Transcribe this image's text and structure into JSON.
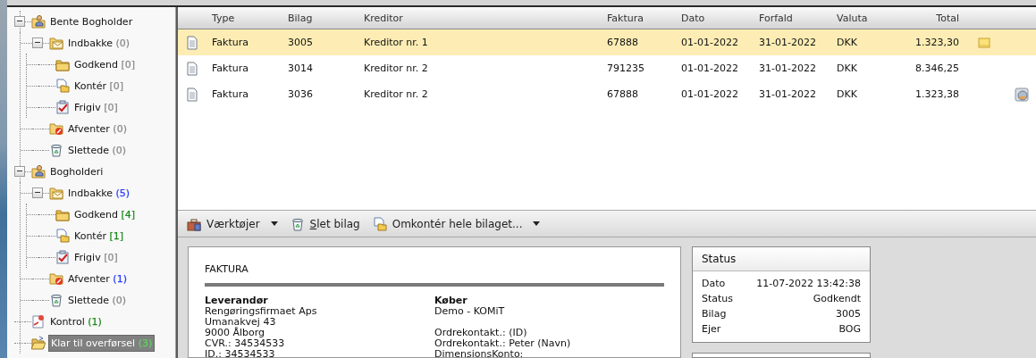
{
  "tree": [
    {
      "kind": "user",
      "label": "Bente Bogholder",
      "expanded": true,
      "selected": false,
      "children": [
        {
          "kind": "inbox",
          "label": "Indbakke",
          "count": "(0)",
          "color": "#8a8a8a",
          "expanded": true,
          "selected": false,
          "children": [
            {
              "kind": "approve",
              "label": "Godkend",
              "count": "[0]",
              "color": "#8a8a8a",
              "selected": false
            },
            {
              "kind": "post",
              "label": "Kontér",
              "count": "[0]",
              "color": "#8a8a8a",
              "selected": false
            },
            {
              "kind": "release",
              "label": "Frigiv",
              "count": "[0]",
              "color": "#8a8a8a",
              "selected": false
            }
          ]
        },
        {
          "kind": "waiting",
          "label": "Afventer",
          "count": "(0)",
          "color": "#8a8a8a",
          "selected": false
        },
        {
          "kind": "deleted",
          "label": "Slettede",
          "count": "(0)",
          "color": "#8a8a8a",
          "selected": false
        }
      ]
    },
    {
      "kind": "user",
      "label": "Bogholderi",
      "expanded": true,
      "selected": false,
      "children": [
        {
          "kind": "inbox",
          "label": "Indbakke",
          "count": "(5)",
          "color": "#2a3cff",
          "expanded": true,
          "selected": false,
          "children": [
            {
              "kind": "approve",
              "label": "Godkend",
              "count": "[4]",
              "color": "#1e8a1e",
              "selected": false
            },
            {
              "kind": "post",
              "label": "Kontér",
              "count": "[1]",
              "color": "#1e8a1e",
              "selected": false
            },
            {
              "kind": "release",
              "label": "Frigiv",
              "count": "[0]",
              "color": "#8a8a8a",
              "selected": false
            }
          ]
        },
        {
          "kind": "waiting",
          "label": "Afventer",
          "count": "(1)",
          "color": "#2a3cff",
          "selected": false
        },
        {
          "kind": "deleted",
          "label": "Slettede",
          "count": "(0)",
          "color": "#8a8a8a",
          "selected": false
        }
      ]
    },
    {
      "kind": "control",
      "label": "Kontrol",
      "count": "(1)",
      "color": "#1e8a1e",
      "selected": false
    },
    {
      "kind": "transfer",
      "label": "Klar til overførsel",
      "count": "(3)",
      "color": "#5fd35f",
      "selected": true
    }
  ],
  "table": {
    "columns": [
      "Type",
      "Bilag",
      "Kreditor",
      "Faktura",
      "Dato",
      "Forfald",
      "Valuta",
      "Total"
    ],
    "rows": [
      {
        "selected": true,
        "note": true,
        "cells": [
          "Faktura",
          "3005",
          "Kreditor nr. 1",
          "67888",
          "01-01-2022",
          "31-01-2022",
          "DKK",
          "1.323,30"
        ]
      },
      {
        "selected": false,
        "cells": [
          "Faktura",
          "3014",
          "Kreditor nr. 2",
          "791235",
          "01-01-2022",
          "31-01-2022",
          "DKK",
          "8.346,25"
        ]
      },
      {
        "selected": false,
        "attachment": true,
        "cells": [
          "Faktura",
          "3036",
          "Kreditor nr. 2",
          "67888",
          "01-01-2022",
          "31-01-2022",
          "DKK",
          "1.323,38"
        ]
      }
    ]
  },
  "toolbar": [
    {
      "kind": "tools",
      "label": "Værktøjer",
      "menu": true
    },
    {
      "kind": "delete",
      "label": "Slet bilag",
      "accelerator": true
    },
    {
      "kind": "post",
      "label": "Omkontér hele bilaget...",
      "menu": true
    }
  ],
  "document": {
    "title": "FAKTURA",
    "columns": [
      {
        "heading": "Leverandør",
        "paragraphs": [
          [
            "Rengøringsfirmaet Aps",
            "Umanakvej 43",
            "9000 Ålborg",
            "CVR.: 34534533",
            "ID.: 34534533"
          ]
        ]
      },
      {
        "heading": "Køber",
        "paragraphs": [
          [
            "Demo - KOMiT"
          ],
          [
            "Ordrekontakt.: (ID)",
            "Ordrekontakt.: Peter (Navn)",
            "DimensionsKonto:"
          ]
        ]
      }
    ]
  },
  "status": {
    "title": "Status",
    "rows": [
      {
        "label": "Dato",
        "value": "11-07-2022 13:42:38"
      },
      {
        "label": "Status",
        "value": "Godkendt"
      },
      {
        "label": "Bilag",
        "value": "3005"
      },
      {
        "label": "Ejer",
        "value": "BOG"
      }
    ]
  }
}
